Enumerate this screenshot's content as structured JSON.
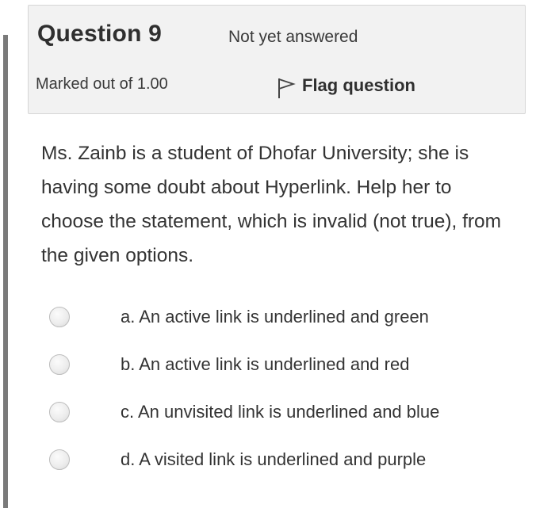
{
  "question": {
    "title": "Question 9",
    "state": "Not yet answered",
    "grade": "Marked out of 1.00",
    "flag_label": "Flag question",
    "flag_icon": "flag-icon",
    "text": "Ms. Zainb is a student of Dhofar University; she is having some doubt about Hyperlink. Help her to choose the statement, which is invalid (not true), from the given options."
  },
  "answers": [
    {
      "label": "a. An active link is underlined and green",
      "selected": false
    },
    {
      "label": "b. An active link is underlined and red",
      "selected": false
    },
    {
      "label": "c. An unvisited link is underlined and blue",
      "selected": false
    },
    {
      "label": "d. A visited link is underlined and purple",
      "selected": false
    }
  ]
}
